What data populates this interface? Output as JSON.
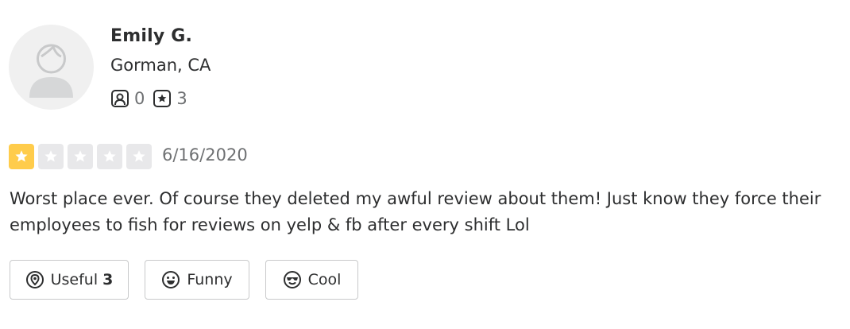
{
  "user": {
    "name": "Emily G.",
    "location": "Gorman, CA",
    "friends_count": "0",
    "reviews_count": "3",
    "avatar_icon": "default-avatar-icon"
  },
  "review": {
    "rating": 1,
    "rating_max": 5,
    "date": "6/16/2020",
    "text": "Worst place ever. Of course they deleted my awful review about them! Just know they force their employees to fish for reviews on yelp & fb after every shift Lol"
  },
  "reactions": {
    "useful_label": "Useful",
    "useful_count": "3",
    "funny_label": "Funny",
    "cool_label": "Cool"
  },
  "colors": {
    "star_filled": "#ffcc4b",
    "star_empty": "#e8e8ea",
    "text": "#2d2e2f",
    "muted": "#6e7072"
  }
}
